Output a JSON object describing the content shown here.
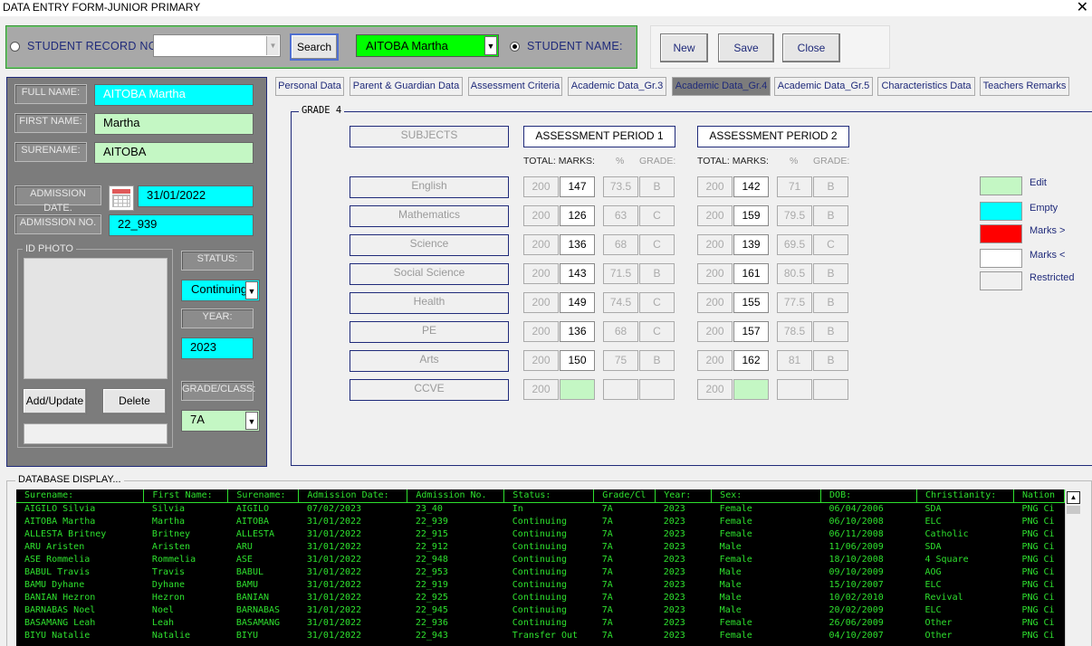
{
  "window": {
    "title": "DATA ENTRY FORM-JUNIOR PRIMARY",
    "close_glyph": "✕"
  },
  "search": {
    "student_record_label": "STUDENT RECORD NO:",
    "record_value": "",
    "search_button": "Search",
    "name_value": "AITOBA Martha",
    "student_name_label": "STUDENT NAME:"
  },
  "nav": {
    "new": "New",
    "save": "Save",
    "close": "Close"
  },
  "left": {
    "full_name_label": "FULL NAME:",
    "full_name": "AITOBA Martha",
    "first_name_label": "FIRST NAME:",
    "first_name": "Martha",
    "surname_label": "SURENAME:",
    "surname": "AITOBA",
    "admission_date_label": "ADMISSION DATE.",
    "admission_date": "31/01/2022",
    "admission_no_label": "ADMISSION NO.",
    "admission_no": "22_939",
    "id_photo_label": "ID PHOTO",
    "status_label": "STATUS:",
    "status": "Continuing",
    "year_label": "YEAR:",
    "year": "2023",
    "grade_label": "GRADE/CLASS:",
    "grade": "7A",
    "add_update": "Add/Update",
    "delete": "Delete"
  },
  "tabs": [
    "Personal Data",
    "Parent & Guardian Data",
    "Assessment Criteria",
    "Academic Data_Gr.3",
    "Academic Data_Gr.4",
    "Academic Data_Gr.5",
    "Characteristics Data",
    "Teachers Remarks"
  ],
  "active_tab": "Academic Data_Gr.4",
  "grade": {
    "group_title": "GRADE 4",
    "subjects_header": "SUBJECTS",
    "period1": "ASSESSMENT PERIOD 1",
    "period2": "ASSESSMENT PERIOD 2",
    "total_marks": "TOTAL: MARKS:",
    "pct": "%",
    "grade_col": "GRADE:",
    "rows": [
      {
        "subject": "English",
        "p1_total": "200",
        "p1_mark": "147",
        "p1_pct": "73.5",
        "p1_grade": "B",
        "p2_total": "200",
        "p2_mark": "142",
        "p2_pct": "71",
        "p2_grade": "B"
      },
      {
        "subject": "Mathematics",
        "p1_total": "200",
        "p1_mark": "126",
        "p1_pct": "63",
        "p1_grade": "C",
        "p2_total": "200",
        "p2_mark": "159",
        "p2_pct": "79.5",
        "p2_grade": "B"
      },
      {
        "subject": "Science",
        "p1_total": "200",
        "p1_mark": "136",
        "p1_pct": "68",
        "p1_grade": "C",
        "p2_total": "200",
        "p2_mark": "139",
        "p2_pct": "69.5",
        "p2_grade": "C"
      },
      {
        "subject": "Social Science",
        "p1_total": "200",
        "p1_mark": "143",
        "p1_pct": "71.5",
        "p1_grade": "B",
        "p2_total": "200",
        "p2_mark": "161",
        "p2_pct": "80.5",
        "p2_grade": "B"
      },
      {
        "subject": "Health",
        "p1_total": "200",
        "p1_mark": "149",
        "p1_pct": "74.5",
        "p1_grade": "C",
        "p2_total": "200",
        "p2_mark": "155",
        "p2_pct": "77.5",
        "p2_grade": "B"
      },
      {
        "subject": "PE",
        "p1_total": "200",
        "p1_mark": "136",
        "p1_pct": "68",
        "p1_grade": "C",
        "p2_total": "200",
        "p2_mark": "157",
        "p2_pct": "78.5",
        "p2_grade": "B"
      },
      {
        "subject": "Arts",
        "p1_total": "200",
        "p1_mark": "150",
        "p1_pct": "75",
        "p1_grade": "B",
        "p2_total": "200",
        "p2_mark": "162",
        "p2_pct": "81",
        "p2_grade": "B"
      },
      {
        "subject": "CCVE",
        "p1_total": "200",
        "p1_mark": "",
        "p1_pct": "",
        "p1_grade": "",
        "p2_total": "200",
        "p2_mark": "",
        "p2_pct": "",
        "p2_grade": ""
      }
    ]
  },
  "legend": [
    {
      "label": "Edit",
      "color": "#c4f7c4"
    },
    {
      "label": "Empty",
      "color": "#00ffff"
    },
    {
      "label": "Marks >",
      "color": "#ff0000"
    },
    {
      "label": "Marks <",
      "color": "#ffffff"
    },
    {
      "label": "Restricted",
      "color": "#f0f0f0"
    }
  ],
  "database": {
    "title": "DATABASE DISPLAY...",
    "columns": [
      "Surename:",
      "First Name:",
      "Surename:",
      "Admission Date:",
      "Admission No.",
      "Status:",
      "Grade/Cl",
      "Year:",
      "Sex:",
      "DOB:",
      "Christianity:",
      "Nation"
    ],
    "rows": [
      [
        "AIGILO Silvia",
        "Silvia",
        "AIGILO",
        "07/02/2023",
        "23_40",
        "In",
        "7A",
        "2023",
        "Female",
        "06/04/2006",
        "SDA",
        "PNG Ci"
      ],
      [
        "AITOBA Martha",
        "Martha",
        "AITOBA",
        "31/01/2022",
        "22_939",
        "Continuing",
        "7A",
        "2023",
        "Female",
        "06/10/2008",
        "ELC",
        "PNG Ci"
      ],
      [
        "ALLESTA Britney",
        "Britney",
        "ALLESTA",
        "31/01/2022",
        "22_915",
        "Continuing",
        "7A",
        "2023",
        "Female",
        "06/11/2008",
        "Catholic",
        "PNG Ci"
      ],
      [
        "ARU Aristen",
        "Aristen",
        "ARU",
        "31/01/2022",
        "22_912",
        "Continuing",
        "7A",
        "2023",
        "Male",
        "11/06/2009",
        "SDA",
        "PNG Ci"
      ],
      [
        "ASE Rommelia",
        "Rommelia",
        "ASE",
        "31/01/2022",
        "22_948",
        "Continuing",
        "7A",
        "2023",
        "Female",
        "18/10/2008",
        "4 Square",
        "PNG Ci"
      ],
      [
        "BABUL Travis",
        "Travis",
        "BABUL",
        "31/01/2022",
        "22_953",
        "Continuing",
        "7A",
        "2023",
        "Male",
        "09/10/2009",
        "AOG",
        "PNG Ci"
      ],
      [
        "BAMU Dyhane",
        "Dyhane",
        "BAMU",
        "31/01/2022",
        "22_919",
        "Continuing",
        "7A",
        "2023",
        "Male",
        "15/10/2007",
        "ELC",
        "PNG Ci"
      ],
      [
        "BANIAN Hezron",
        "Hezron",
        "BANIAN",
        "31/01/2022",
        "22_925",
        "Continuing",
        "7A",
        "2023",
        "Male",
        "10/02/2010",
        "Revival",
        "PNG Ci"
      ],
      [
        "BARNABAS Noel",
        "Noel",
        "BARNABAS",
        "31/01/2022",
        "22_945",
        "Continuing",
        "7A",
        "2023",
        "Male",
        "20/02/2009",
        "ELC",
        "PNG Ci"
      ],
      [
        "BASAMANG Leah",
        "Leah",
        "BASAMANG",
        "31/01/2022",
        "22_936",
        "Continuing",
        "7A",
        "2023",
        "Female",
        "26/06/2009",
        "Other",
        "PNG Ci"
      ],
      [
        "BIYU Natalie",
        "Natalie",
        "BIYU",
        "31/01/2022",
        "22_943",
        "Transfer Out",
        "7A",
        "2023",
        "Female",
        "04/10/2007",
        "Other",
        "PNG Ci"
      ]
    ]
  }
}
